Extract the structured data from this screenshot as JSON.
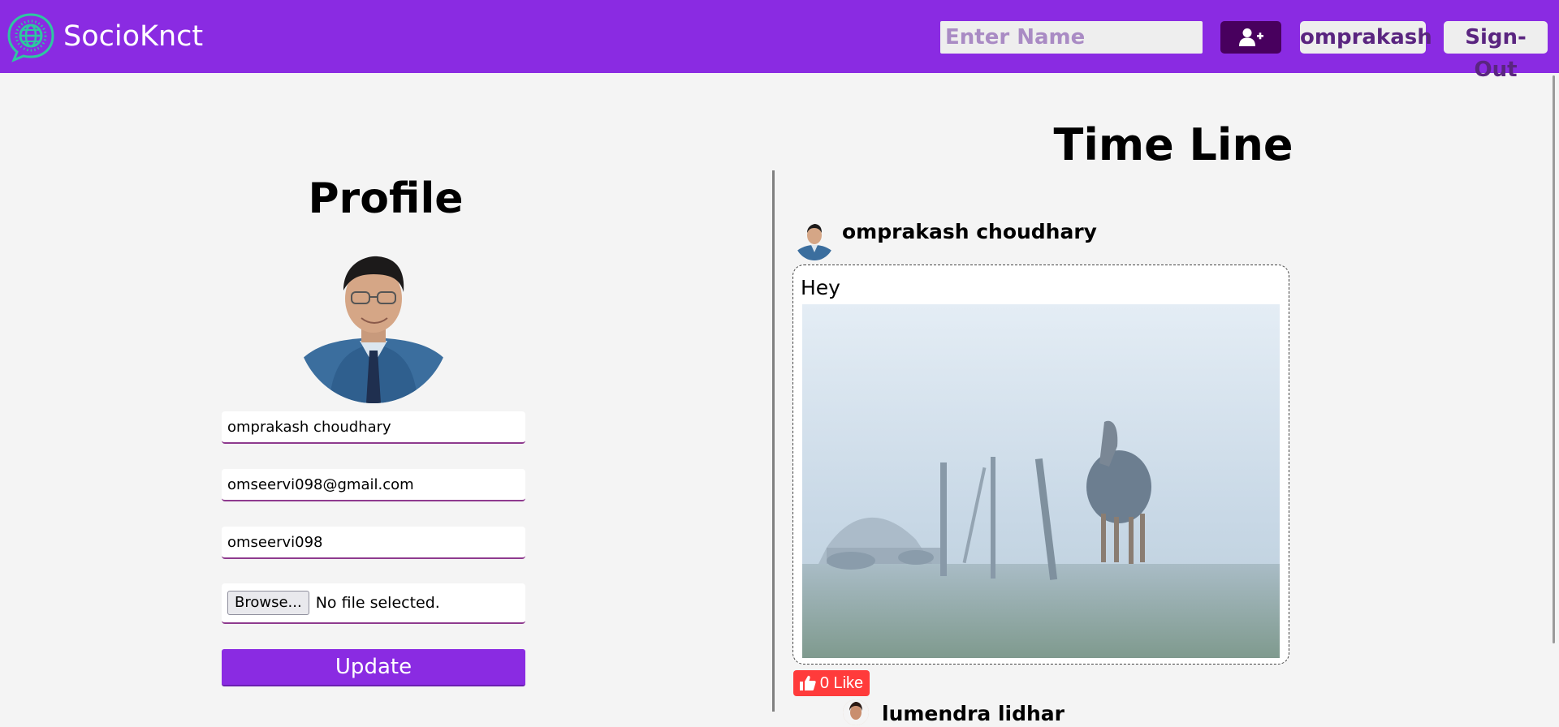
{
  "header": {
    "brand_name": "SocioKnct",
    "brand_icon": "globe-chat-icon",
    "search_placeholder": "Enter Name",
    "add_friend_icon": "user-plus-icon",
    "user_label": "omprakash",
    "signout_label": "Sign-Out"
  },
  "profile": {
    "title": "Profile",
    "name_value": "omprakash choudhary",
    "email_value": "omseervi098@gmail.com",
    "username_value": "omseervi098",
    "browse_label": "Browse...",
    "file_status": "No file selected.",
    "update_label": "Update"
  },
  "timeline": {
    "title": "Time Line",
    "posts": [
      {
        "author": "omprakash choudhary",
        "text": "Hey",
        "like_label": "0 Like",
        "like_icon": "thumbs-up-icon"
      },
      {
        "author": "lumendra lidhar"
      }
    ]
  },
  "colors": {
    "brand_purple": "#8a2be2",
    "add_button": "#48005e",
    "like_red": "#ff3b3b",
    "header_button_text": "#5a2580"
  }
}
